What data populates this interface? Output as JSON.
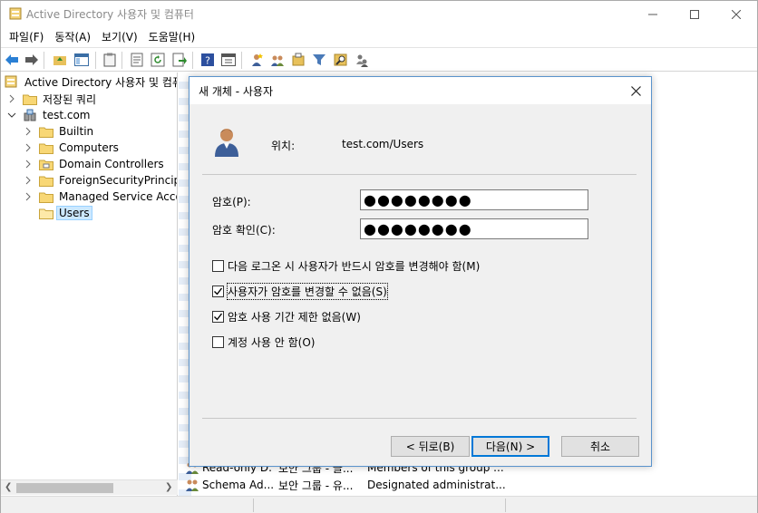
{
  "window": {
    "title": "Active Directory 사용자 및 컴퓨터"
  },
  "menu": [
    "파일(F)",
    "동작(A)",
    "보기(V)",
    "도움말(H)"
  ],
  "tree": {
    "root": "Active Directory 사용자 및 컴퓨터",
    "saved_queries": "저장된 쿼리",
    "domain": "test.com",
    "children": [
      "Builtin",
      "Computers",
      "Domain Controllers",
      "ForeignSecurityPrincipals",
      "Managed Service Accounts",
      "Users"
    ],
    "selected": "Users"
  },
  "list": {
    "rows": [
      {
        "name": "Read-only D...",
        "type": "보안 그룹 - 글...",
        "description": "Members of this group ..."
      },
      {
        "name": "Schema Ad...",
        "type": "보안 그룹 - 유...",
        "description": "Designated administrat..."
      }
    ]
  },
  "dialog": {
    "title": "새 개체 - 사용자",
    "location_label": "위치:",
    "location_value": "test.com/Users",
    "password_label": "암호(P):",
    "password_value": "●●●●●●●●",
    "confirm_label": "암호 확인(C):",
    "confirm_value": "●●●●●●●●",
    "options": [
      {
        "label": "다음 로그온 시 사용자가 반드시 암호를 변경해야 함(M)",
        "checked": false
      },
      {
        "label": "사용자가 암호를 변경할 수 없음(S)",
        "checked": true
      },
      {
        "label": "암호 사용 기간 제한 없음(W)",
        "checked": true
      },
      {
        "label": "계정 사용 안 함(O)",
        "checked": false
      }
    ],
    "buttons": {
      "back": "< 뒤로(B)",
      "next": "다음(N) >",
      "cancel": "취소"
    }
  }
}
